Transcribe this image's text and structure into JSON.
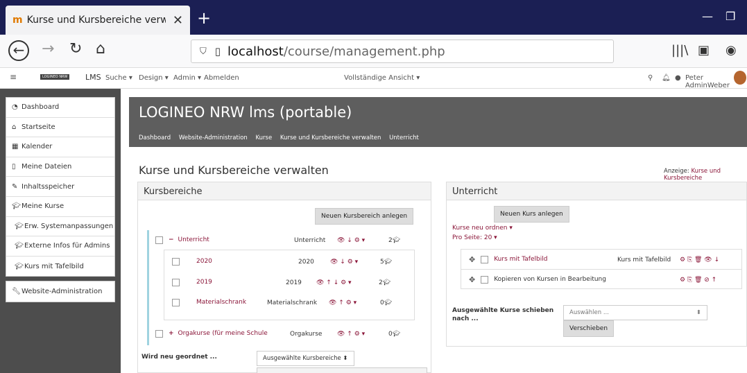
{
  "browser": {
    "tab_title": "Kurse und Kursbereiche verwalt",
    "url_host": "localhost",
    "url_path": "/course/management.php"
  },
  "topnav": {
    "brand": "LOGINEO NRW",
    "lms": "LMS",
    "menus": [
      "Suche ▾",
      "Design ▾",
      "Admin ▾",
      "Abmelden"
    ],
    "view": "Vollständige Ansicht ▾",
    "user": "Peter AdminWeber"
  },
  "sidebar": {
    "items": [
      {
        "label": "Dashboard",
        "icon": "dashboard-icon"
      },
      {
        "label": "Startseite",
        "icon": "home-icon"
      },
      {
        "label": "Kalender",
        "icon": "calendar-icon"
      },
      {
        "label": "Meine Dateien",
        "icon": "file-icon"
      },
      {
        "label": "Inhaltsspeicher",
        "icon": "brush-icon"
      },
      {
        "label": "Meine Kurse",
        "icon": "graduation-cap-icon"
      }
    ],
    "courses": [
      "Erw. Systemanpassungen",
      "Externe Infos für Admins",
      "Kurs mit Tafelbild"
    ],
    "admin": "Website-Administration"
  },
  "header": {
    "title": "LOGINEO NRW lms (portable)",
    "breadcrumbs": [
      "Dashboard",
      "Website-Administration",
      "Kurse",
      "Kurse und Kursbereiche verwalten",
      "Unterricht"
    ]
  },
  "page": {
    "title": "Kurse und Kursbereiche verwalten",
    "anzeige_label": "Anzeige:",
    "anzeige_value": "Kurse und Kursbereiche"
  },
  "left_panel": {
    "title": "Kursbereiche",
    "new_button": "Neuen Kursbereich anlegen",
    "categories": [
      {
        "name": "Unterricht",
        "idnumber": "Unterricht",
        "count": "2"
      },
      {
        "name": "2020",
        "idnumber": "2020",
        "count": "5"
      },
      {
        "name": "2019",
        "idnumber": "2019",
        "count": "2"
      },
      {
        "name": "Materialschrank",
        "idnumber": "Materialschrank",
        "count": "0"
      },
      {
        "name": "Orgakurse (für meine Schule",
        "idnumber": "Orgakurse",
        "count": "0"
      }
    ],
    "reorder_label": "Wird neu geordnet ...",
    "reorder_select": "Ausgewählte Kursbereiche"
  },
  "right_panel": {
    "title": "Unterricht",
    "new_button": "Neuen Kurs anlegen",
    "reorder": "Kurse neu ordnen ▾",
    "per_page": "Pro Seite: 20 ▾",
    "courses": [
      {
        "name": "Kurs mit Tafelbild",
        "short": "Kurs mit Tafelbild"
      },
      {
        "name": "Kopieren von Kursen in Bearbeitung",
        "short": ""
      }
    ],
    "move_label_1": "Ausgewählte Kurse schieben",
    "move_label_2": "nach ...",
    "move_select": "Auswählen ...",
    "move_button": "Verschieben"
  }
}
